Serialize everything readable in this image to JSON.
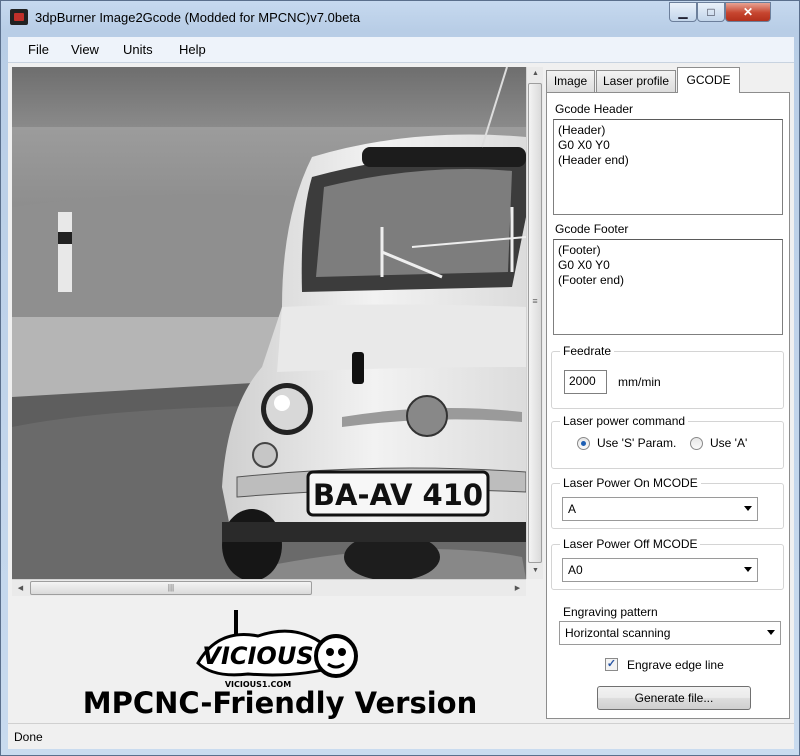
{
  "window": {
    "title": "3dpBurner Image2Gcode (Modded for MPCNC)v7.0beta",
    "minimize_glyph": "▁",
    "maximize_glyph": "□",
    "close_glyph": "✕"
  },
  "menu": [
    "File",
    "View",
    "Units",
    "Help"
  ],
  "image_view": {
    "plate_text": "BA-AV 410",
    "hscroll_grip": "|||",
    "vscroll_grip": "≡"
  },
  "branding": {
    "logo_text": "VICIOUS",
    "logo_subtext": "VICIOUS1.COM",
    "caption": "MPCNC-Friendly Version"
  },
  "tabs": [
    {
      "label": "Image"
    },
    {
      "label": "Laser profile"
    },
    {
      "label": "GCODE",
      "selected": true
    }
  ],
  "gcode": {
    "header_label": "Gcode Header",
    "header_text": "(Header)\nG0 X0 Y0\n(Header end)",
    "footer_label": "Gcode Footer",
    "footer_text": "(Footer)\nG0 X0 Y0\n(Footer end)",
    "feedrate_label": "Feedrate",
    "feedrate_value": "2000",
    "feedrate_unit": "mm/min",
    "laser_cmd_label": "Laser power command",
    "laser_cmd_option_s": "Use 'S' Param.",
    "laser_cmd_option_a": "Use 'A'",
    "laser_cmd_selected": "s",
    "laser_on_label": "Laser Power On MCODE",
    "laser_on_value": "A",
    "laser_off_label": "Laser Power Off MCODE",
    "laser_off_value": "A0",
    "pattern_label": "Engraving pattern",
    "pattern_value": "Horizontal scanning",
    "edge_line_label": "Engrave edge line",
    "edge_line_checked": true,
    "generate_button": "Generate file..."
  },
  "status": {
    "text": "Done"
  },
  "colors": {
    "accent": "#1e5fb4",
    "close_button": "#c6452f",
    "titlebar": "#c6d9ef"
  }
}
